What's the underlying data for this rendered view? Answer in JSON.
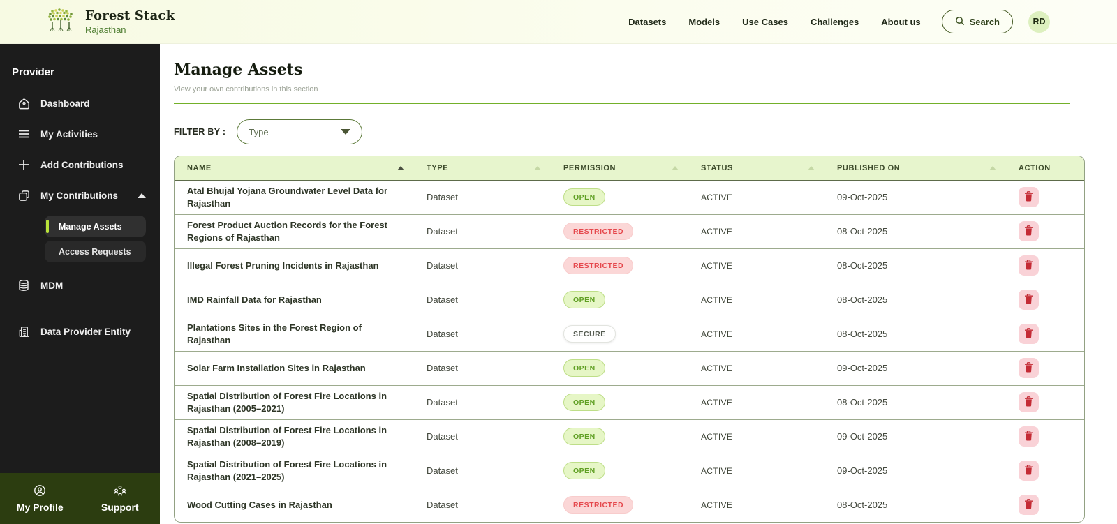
{
  "header": {
    "brand": {
      "title": "Forest Stack",
      "subtitle": "Rajasthan"
    },
    "nav": [
      {
        "label": "Datasets"
      },
      {
        "label": "Models"
      },
      {
        "label": "Use Cases"
      },
      {
        "label": "Challenges"
      },
      {
        "label": "About us"
      }
    ],
    "search_label": "Search",
    "avatar_initials": "RD"
  },
  "sidebar": {
    "heading": "Provider",
    "items": [
      {
        "label": "Dashboard",
        "icon": "home-icon"
      },
      {
        "label": "My Activities",
        "icon": "list-icon"
      },
      {
        "label": "Add Contributions",
        "icon": "plus-icon"
      },
      {
        "label": "My Contributions",
        "icon": "copy-icon",
        "expanded": true
      },
      {
        "label": "MDM",
        "icon": "database-icon"
      },
      {
        "label": "Data Provider Entity",
        "icon": "building-icon"
      }
    ],
    "submenu": [
      {
        "label": "Manage Assets",
        "active": true
      },
      {
        "label": "Access Requests",
        "active": false
      }
    ],
    "footer": [
      {
        "label": "My Profile",
        "icon": "profile-icon"
      },
      {
        "label": "Support",
        "icon": "support-icon"
      }
    ]
  },
  "main": {
    "title": "Manage Assets",
    "subtitle": "View your own contributions in this section",
    "filter_label": "FILTER BY :",
    "filter_type_value": "Type",
    "table": {
      "columns": [
        {
          "label": "NAME",
          "sorted": true
        },
        {
          "label": "TYPE",
          "sorted": false
        },
        {
          "label": "PERMISSION",
          "sorted": false
        },
        {
          "label": "STATUS",
          "sorted": false
        },
        {
          "label": "PUBLISHED ON",
          "sorted": false
        },
        {
          "label": "ACTION",
          "sorted": false
        }
      ],
      "rows": [
        {
          "name": "Atal Bhujal Yojana Groundwater Level Data for Rajasthan",
          "type": "Dataset",
          "permission": "OPEN",
          "status": "ACTIVE",
          "published": "09-Oct-2025"
        },
        {
          "name": "Forest Product Auction Records for the Forest Regions of Rajasthan",
          "type": "Dataset",
          "permission": "RESTRICTED",
          "status": "ACTIVE",
          "published": "08-Oct-2025"
        },
        {
          "name": "Illegal Forest Pruning Incidents in Rajasthan",
          "type": "Dataset",
          "permission": "RESTRICTED",
          "status": "ACTIVE",
          "published": "08-Oct-2025"
        },
        {
          "name": "IMD Rainfall Data for Rajasthan",
          "type": "Dataset",
          "permission": "OPEN",
          "status": "ACTIVE",
          "published": "08-Oct-2025"
        },
        {
          "name": "Plantations Sites in the Forest Region of Rajasthan",
          "type": "Dataset",
          "permission": "SECURE",
          "status": "ACTIVE",
          "published": "08-Oct-2025"
        },
        {
          "name": "Solar Farm Installation Sites in Rajasthan",
          "type": "Dataset",
          "permission": "OPEN",
          "status": "ACTIVE",
          "published": "09-Oct-2025"
        },
        {
          "name": "Spatial Distribution of Forest Fire Locations in Rajasthan (2005–2021)",
          "type": "Dataset",
          "permission": "OPEN",
          "status": "ACTIVE",
          "published": "08-Oct-2025"
        },
        {
          "name": "Spatial Distribution of Forest Fire Locations in Rajasthan (2008–2019)",
          "type": "Dataset",
          "permission": "OPEN",
          "status": "ACTIVE",
          "published": "09-Oct-2025"
        },
        {
          "name": "Spatial Distribution of Forest Fire Locations in Rajasthan (2021–2025)",
          "type": "Dataset",
          "permission": "OPEN",
          "status": "ACTIVE",
          "published": "09-Oct-2025"
        },
        {
          "name": "Wood Cutting Cases in Rajasthan",
          "type": "Dataset",
          "permission": "RESTRICTED",
          "status": "ACTIVE",
          "published": "08-Oct-2025"
        }
      ]
    }
  },
  "colors": {
    "accent_green": "#73b029",
    "header_bg": "#f9fce9",
    "sidebar_bg": "#1c1c1c",
    "sidebar_footer_bg": "#2c3d10",
    "active_item_bar": "#b8e23a",
    "table_header_bg": "#e7f5cd",
    "badge_open_text": "#5f9f23",
    "badge_restricted_text": "#e5484d",
    "delete_red": "#c62f38"
  }
}
